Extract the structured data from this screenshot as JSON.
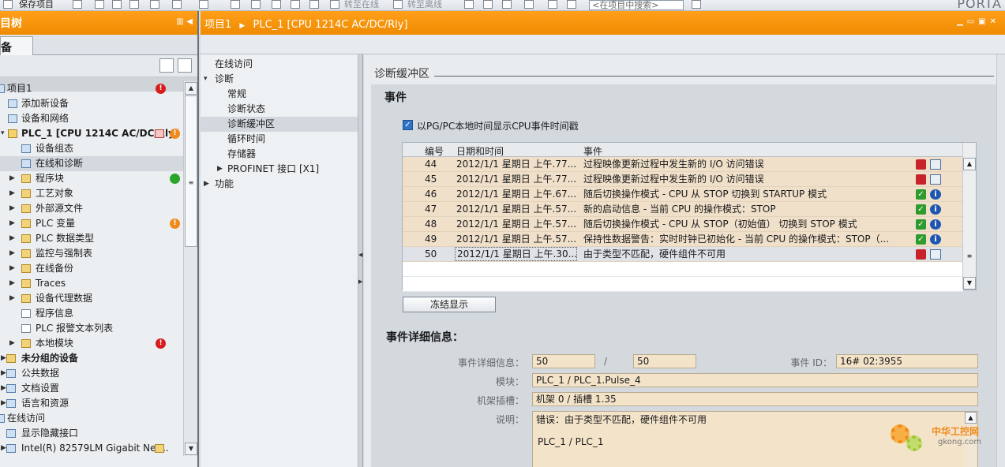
{
  "toolbar": {
    "save_project": "保存项目",
    "go_online": "转至在线",
    "go_offline": "转至离线",
    "search_placeholder": "<在项目中搜索>",
    "brand": "PORTA"
  },
  "left_panel": {
    "title": "目树",
    "tab": "备",
    "tree": [
      {
        "label": "项目1",
        "status": "error"
      },
      {
        "label": "添加新设备"
      },
      {
        "label": "设备和网络"
      },
      {
        "label": "PLC_1 [CPU 1214C AC/DC/Rly]",
        "status": "warning"
      },
      {
        "label": "设备组态"
      },
      {
        "label": "在线和诊断"
      },
      {
        "label": "程序块",
        "status": "ok"
      },
      {
        "label": "工艺对象"
      },
      {
        "label": "外部源文件"
      },
      {
        "label": "PLC 变量",
        "status": "warning"
      },
      {
        "label": "PLC 数据类型"
      },
      {
        "label": "监控与强制表"
      },
      {
        "label": "在线备份"
      },
      {
        "label": "Traces"
      },
      {
        "label": "设备代理数据"
      },
      {
        "label": "程序信息"
      },
      {
        "label": "PLC 报警文本列表"
      },
      {
        "label": "本地模块",
        "status": "error"
      },
      {
        "label": "未分组的设备"
      },
      {
        "label": "公共数据"
      },
      {
        "label": "文档设置"
      },
      {
        "label": "语言和资源"
      },
      {
        "label": "在线访问"
      },
      {
        "label": "显示隐藏接口"
      },
      {
        "label": "Intel(R) 82579LM Gigabit Net..."
      }
    ]
  },
  "editor": {
    "breadcrumb_root": "项目1",
    "breadcrumb_device": "PLC_1 [CPU 1214C AC/DC/Rly]",
    "nav": [
      {
        "label": "在线访问"
      },
      {
        "label": "诊断"
      },
      {
        "label": "常规"
      },
      {
        "label": "诊断状态"
      },
      {
        "label": "诊断缓冲区"
      },
      {
        "label": "循环时间"
      },
      {
        "label": "存储器"
      },
      {
        "label": "PROFINET 接口 [X1]"
      },
      {
        "label": "功能"
      }
    ]
  },
  "diag_buffer": {
    "section_title": "诊断缓冲区",
    "events_title": "事件",
    "checkbox_label": "以PG/PC本地时间显示CPU事件时间戳",
    "checkbox_checked": true,
    "columns": {
      "num": "编号",
      "datetime": "日期和时间",
      "event": "事件"
    },
    "rows": [
      {
        "num": "44",
        "datetime": "2012/1/1 星期日 上午.77...",
        "event": "过程映像更新过程中发生新的 I/O 访问错误",
        "kind": "error"
      },
      {
        "num": "45",
        "datetime": "2012/1/1 星期日 上午.77...",
        "event": "过程映像更新过程中发生新的 I/O 访问错误",
        "kind": "error"
      },
      {
        "num": "46",
        "datetime": "2012/1/1 星期日 上午.67...",
        "event": "随后切换操作模式 - CPU 从 STOP 切换到 STARTUP 模式",
        "kind": "info"
      },
      {
        "num": "47",
        "datetime": "2012/1/1 星期日 上午.57...",
        "event": "新的启动信息 - 当前 CPU 的操作模式：STOP",
        "kind": "info"
      },
      {
        "num": "48",
        "datetime": "2012/1/1 星期日 上午.57...",
        "event": "随后切换操作模式 - CPU 从 STOP（初始值） 切换到 STOP 模式",
        "kind": "info"
      },
      {
        "num": "49",
        "datetime": "2012/1/1 星期日 上午.57...",
        "event": "保持性数据警告：实时时钟已初始化 - 当前 CPU 的操作模式：STOP（...",
        "kind": "info"
      },
      {
        "num": "50",
        "datetime": "2012/1/1 星期日 上午.30...",
        "event": "由于类型不匹配，硬件组件不可用",
        "kind": "error"
      }
    ],
    "freeze_button": "冻结显示"
  },
  "details": {
    "title": "事件详细信息：",
    "detail_label": "事件详细信息：",
    "detail_value": "50",
    "separator": "/",
    "detail_total": "50",
    "event_id_label": "事件 ID：",
    "event_id": "16# 02:3955",
    "module_label": "模块：",
    "module": "PLC_1 / PLC_1.Pulse_4",
    "rack_label": "机架插槽：",
    "rack": "机架 0 / 插槽 1.35",
    "desc_label": "说明：",
    "desc_line1": "错误：由于类型不匹配，硬件组件不可用",
    "desc_line2": "PLC_1 / PLC_1"
  },
  "watermark": {
    "cn": "中华工控网",
    "en": "gkong.com"
  },
  "colors": {
    "accent": "#F39200",
    "row_bg": "#F0E0CA",
    "error": "#C8232A",
    "ok": "#2E9B2E",
    "info": "#1E55B0"
  }
}
